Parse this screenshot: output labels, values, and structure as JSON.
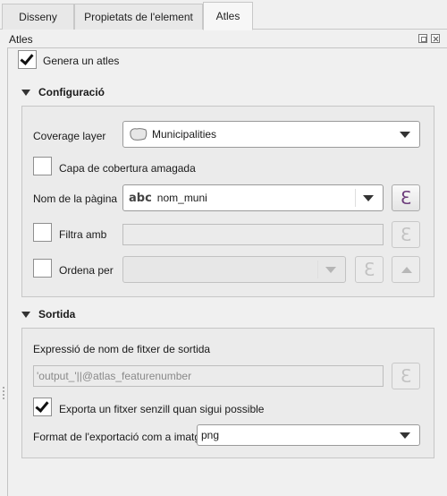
{
  "tabs": [
    {
      "label": "Disseny"
    },
    {
      "label": "Propietats de l'element"
    },
    {
      "label": "Atles",
      "active": true
    }
  ],
  "dock": {
    "title": "Atles"
  },
  "generate": {
    "label": "Genera un atles",
    "checked": true
  },
  "config": {
    "title": "Configuració",
    "coverage_layer": {
      "label": "Coverage layer",
      "value": "Municipalities",
      "icon": "polygon-layer-icon"
    },
    "hidden_coverage": {
      "label": "Capa de cobertura amagada",
      "checked": false
    },
    "page_name": {
      "label": "Nom de la pàgina",
      "prefix": "abc",
      "value": "nom_muni"
    },
    "filter": {
      "label": "Filtra amb",
      "checked": false,
      "value": ""
    },
    "sort": {
      "label": "Ordena per",
      "checked": false,
      "value": ""
    }
  },
  "output": {
    "title": "Sortida",
    "filename_label": "Expressió de nom de fitxer de sortida",
    "filename_expr": "'output_'||@atlas_featurenumber",
    "single_file": {
      "label": "Exporta un fitxer senzill quan sigui possible",
      "checked": true
    },
    "format": {
      "label": "Format de l'exportació com a imatge",
      "value": "png"
    }
  },
  "icons": {
    "expression": "ℇ"
  }
}
